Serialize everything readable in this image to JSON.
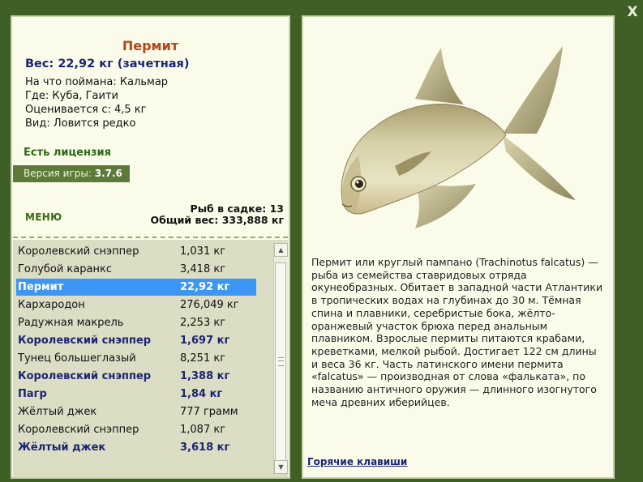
{
  "fish": {
    "title": "Пермит",
    "weight_line": "Вес: 22,92 кг (зачетная)",
    "info": [
      "На что поймана: Кальмар",
      "Где: Куба, Гаити",
      "Оценивается с: 4,5 кг",
      "Вид: Ловится редко"
    ],
    "description": "Пермит или круглый пампано (Trachinotus falcatus) — рыба из семейства ставридовых отряда окунеобразных. Обитает в западной части Атлантики в тропических водах на глубинах до 30 м. Тёмная спина и плавники, серебристые бока, жёлто-оранжевый участок брюха перед анальным плавником. Взрослые пермиты питаются крабами, креветками, мелкой рыбой. Достигает 122 см длины и веса 36 кг. Часть латинского имени пермита «falcatus» — производная от слова «фальката», по названию античного оружия — длинного изогнутого меча древних иберийцев."
  },
  "license": "Есть лицензия",
  "version": {
    "label": "Версия игры:",
    "value": "3.7.6"
  },
  "menu_label": "МЕНЮ",
  "cage": {
    "count": "Рыб в садке: 13",
    "total": "Общий вес: 333,888 кг"
  },
  "catch_list": [
    {
      "name": "Королевский снэппер",
      "weight": "1,031 кг",
      "trophy": false,
      "selected": false
    },
    {
      "name": "Голубой каранкс",
      "weight": "3,418 кг",
      "trophy": false,
      "selected": false
    },
    {
      "name": "Пермит",
      "weight": "22,92 кг",
      "trophy": true,
      "selected": true
    },
    {
      "name": "Кархародон",
      "weight": "276,049 кг",
      "trophy": false,
      "selected": false
    },
    {
      "name": "Радужная макрель",
      "weight": "2,253 кг",
      "trophy": false,
      "selected": false
    },
    {
      "name": "Королевский снэппер",
      "weight": "1,697 кг",
      "trophy": true,
      "selected": false
    },
    {
      "name": "Тунец большеглазый",
      "weight": "8,251 кг",
      "trophy": false,
      "selected": false
    },
    {
      "name": "Королевский снэппер",
      "weight": "1,388 кг",
      "trophy": true,
      "selected": false
    },
    {
      "name": "Пагр",
      "weight": "1,84 кг",
      "trophy": true,
      "selected": false
    },
    {
      "name": "Жёлтый джек",
      "weight": "777 грамм",
      "trophy": false,
      "selected": false
    },
    {
      "name": "Королевский снэппер",
      "weight": "1,087 кг",
      "trophy": false,
      "selected": false
    },
    {
      "name": "Жёлтый джек",
      "weight": "3,618 кг",
      "trophy": true,
      "selected": false
    }
  ],
  "hotkeys_label": "Горячие клавиши",
  "close_label": "X",
  "colors": {
    "background": "#3f5f27",
    "panel": "#fbfbea",
    "selection": "#3e96f4",
    "trophy_text": "#1a2574",
    "title": "#b44718"
  },
  "icons": {
    "close": "close-icon",
    "scroll_up": "chevron-up-icon",
    "scroll_down": "chevron-down-icon"
  }
}
